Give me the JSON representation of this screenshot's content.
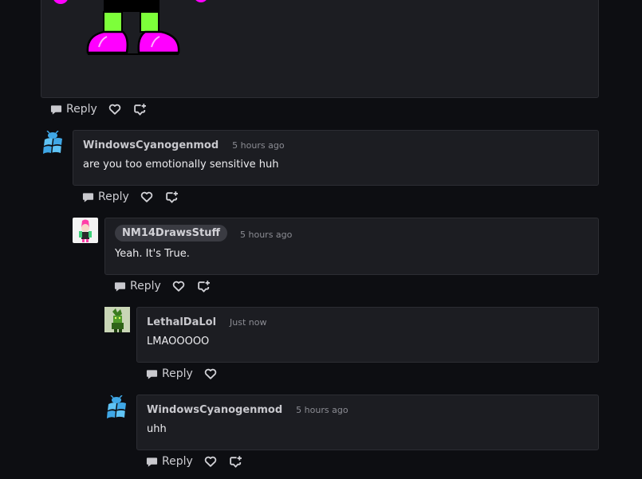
{
  "actions": {
    "reply_label": "Reply"
  },
  "comments": [
    {
      "author": "WindowsCyanogenmod",
      "time": "5 hours ago",
      "body": "are you too emotionally sensitive huh",
      "avatar": "windows-logo-icon"
    },
    {
      "author": "NM14DrawsStuff",
      "time": "5 hours ago",
      "body": "Yeah. It's True.",
      "avatar": "character-drawing"
    },
    {
      "author": "LethalDaLol",
      "time": "Just now",
      "body": "LMAOOOOO",
      "avatar": "green-creature"
    },
    {
      "author": "WindowsCyanogenmod",
      "time": "5 hours ago",
      "body": "uhh",
      "avatar": "windows-logo-icon"
    }
  ],
  "colors": {
    "background": "#0d0e12",
    "card": "#1c1d22",
    "card_border": "#2c2d33",
    "highlight_pill": "#3a3b42",
    "drawing_magenta": "#ff00ff",
    "drawing_green": "#7dff3a"
  }
}
